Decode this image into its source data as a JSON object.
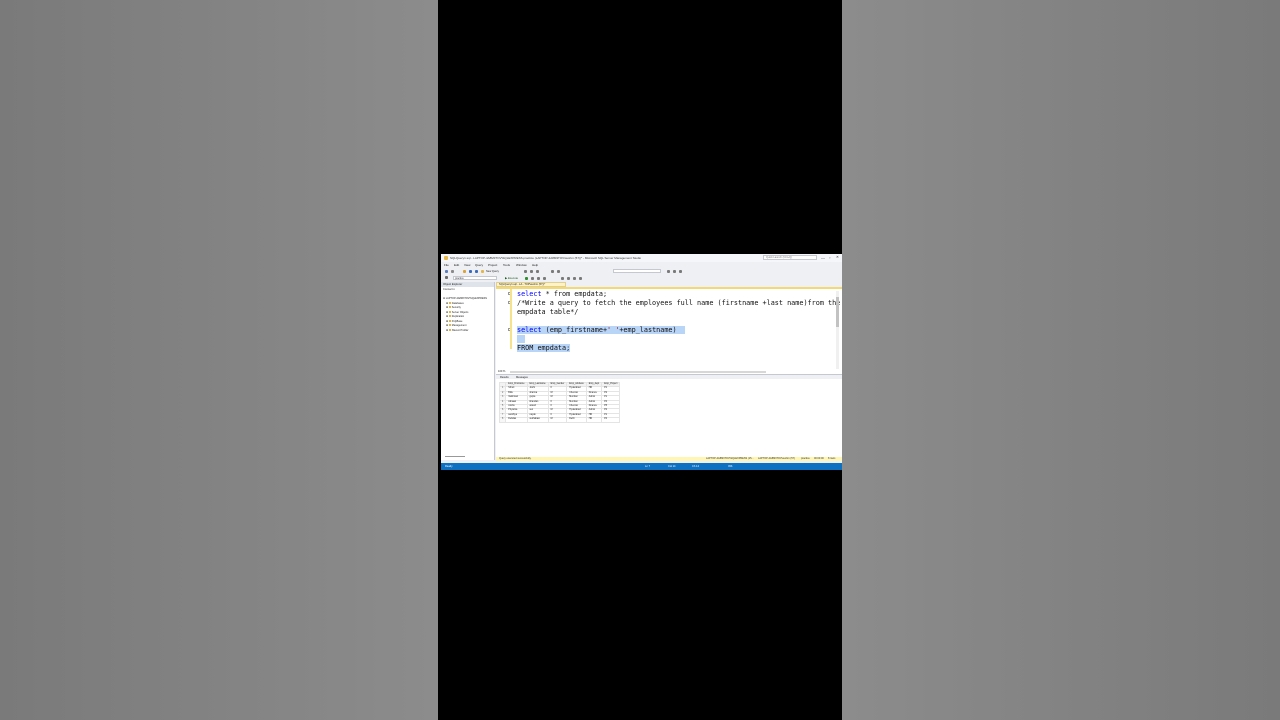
{
  "window": {
    "title": "SQLQuery1.sql - LAPTOP-4A8M3TOV\\SQLEXPRESS.practice (LAPTOP-4A8M3TOV\\sushm (57))* - Microsoft SQL Server Management Studio",
    "quick_launch_placeholder": "Quick Launch (Ctrl+Q)",
    "minimize": "—",
    "maximize": "▫",
    "close": "✕"
  },
  "menu": [
    "File",
    "Edit",
    "View",
    "Query",
    "Project",
    "Tools",
    "Window",
    "Help"
  ],
  "toolbar": {
    "new_query_label": "New Query",
    "database_selector": "practice",
    "execute_label": "Execute"
  },
  "object_explorer": {
    "title": "Object Explorer",
    "connect_label": "Connect ▾",
    "server_node": "LAPTOP-4A8M3TOV\\SQLEXPRESS",
    "nodes": [
      "Databases",
      "Security",
      "Server Objects",
      "Replication",
      "PolyBase",
      "Management",
      "XEvent Profiler"
    ]
  },
  "editor": {
    "tab_title": "SQLQuery1.sql - LA...TOP\\sushm (57))*",
    "lines": {
      "l1_kw": "select",
      "l1_rest": " * from empdata;",
      "l2": "/*Write a query to fetch the employees full name (firstname +last name)from the",
      "l3": "empdata table*/",
      "l5_kw": "select",
      "l5_rest": " (emp_firstname+",
      "l5_str": "' '",
      "l5_tail": "+emp_lastname)",
      "l7": "FROM empdata;"
    }
  },
  "results": {
    "zoom": "100 %",
    "tabs": [
      "Results",
      "Messages"
    ],
    "columns": [
      "Emp_Firstname",
      "Emp_Lastname",
      "Emp_Gender",
      "Emp_Address",
      "Emp_dept",
      "Emp_Project"
    ],
    "rows": [
      [
        "Shruti",
        "Joshi",
        "F",
        "Hyderabad",
        "HR",
        "P1"
      ],
      [
        "Bittu",
        "sharma",
        "M",
        "Chennai",
        "Finance",
        "P2"
      ],
      [
        "Vaishnavi",
        "gupta",
        "M",
        "Mumbai",
        "Admin",
        "P1"
      ],
      [
        "Adnaan",
        "khandan",
        "F",
        "Mumbai",
        "Admin",
        "P4"
      ],
      [
        "Anshu",
        "anand",
        "F",
        "Chennai",
        "Finance",
        "P5"
      ],
      [
        "Priyanka",
        "sen",
        "M",
        "Hyderabad",
        "Admin",
        "P2"
      ],
      [
        "sandhya",
        "nayak",
        "F",
        "Hyderabad",
        "HR",
        "P1"
      ],
      [
        "Debdas",
        "sukhabasi",
        "M",
        "Delhi",
        "HR",
        "P4"
      ]
    ]
  },
  "status_strip": {
    "message": "Query executed successfully.",
    "server": "LAPTOP-4A8M3TOV\\SQLEXPRESS (15...",
    "user": "LAPTOP-4A8M3TOV\\sushm (57)",
    "database": "practice",
    "time": "00:00:00",
    "rows": "8 rows"
  },
  "status_bar": {
    "ready": "Ready",
    "ln": "Ln 7",
    "col": "Col 14",
    "ch": "Ch 14",
    "ins": "INS"
  }
}
